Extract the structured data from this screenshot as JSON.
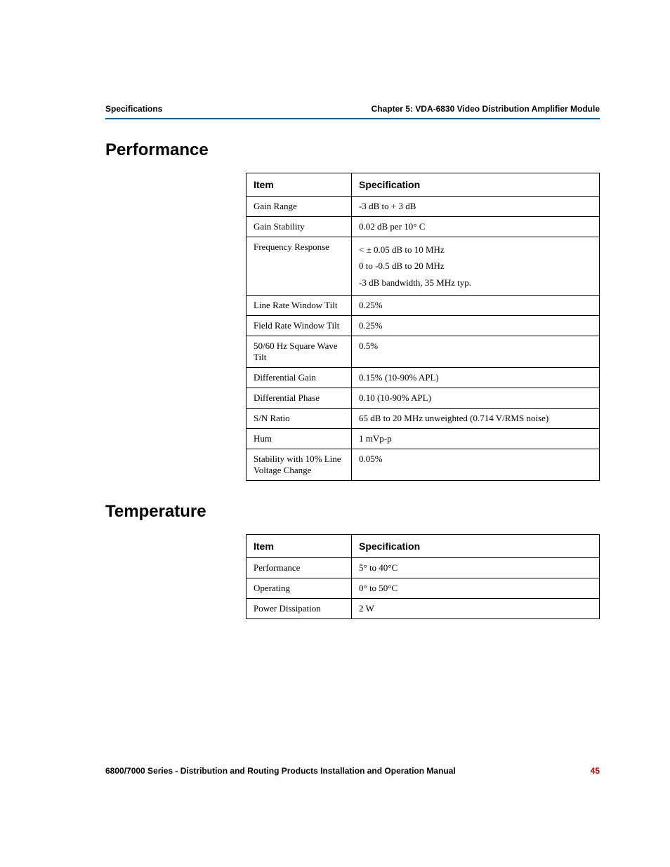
{
  "header": {
    "left": "Specifications",
    "right": "Chapter 5: VDA-6830 Video Distribution Amplifier Module"
  },
  "sections": [
    {
      "title": "Performance",
      "headers": {
        "item": "Item",
        "spec": "Specification"
      },
      "rows": [
        {
          "item": "Gain Range",
          "spec": "-3 dB to + 3 dB"
        },
        {
          "item": "Gain Stability",
          "spec": "0.02 dB per 10° C"
        },
        {
          "item": "Frequency Response",
          "spec": "< ± 0.05 dB to 10 MHz\n0 to -0.5 dB to 20 MHz\n-3 dB bandwidth, 35 MHz typ."
        },
        {
          "item": "Line Rate Window Tilt",
          "spec": "0.25%"
        },
        {
          "item": "Field Rate Window Tilt",
          "spec": "0.25%"
        },
        {
          "item": "50/60 Hz Square Wave Tilt",
          "spec": "0.5%"
        },
        {
          "item": "Differential Gain",
          "spec": "0.15% (10-90% APL)"
        },
        {
          "item": "Differential Phase",
          "spec": "0.10 (10-90% APL)"
        },
        {
          "item": "S/N Ratio",
          "spec": "65 dB to 20 MHz unweighted (0.714 V/RMS noise)"
        },
        {
          "item": "Hum",
          "spec": "1 mVp-p"
        },
        {
          "item": "Stability with 10% Line Voltage Change",
          "spec": "0.05%"
        }
      ]
    },
    {
      "title": "Temperature",
      "headers": {
        "item": "Item",
        "spec": "Specification"
      },
      "rows": [
        {
          "item": "Performance",
          "spec": "5° to 40°C"
        },
        {
          "item": "Operating",
          "spec": "0° to 50°C"
        },
        {
          "item": "Power Dissipation",
          "spec": "2 W"
        }
      ]
    }
  ],
  "footer": {
    "text": "6800/7000 Series - Distribution and Routing Products Installation and Operation Manual",
    "page": "45"
  }
}
